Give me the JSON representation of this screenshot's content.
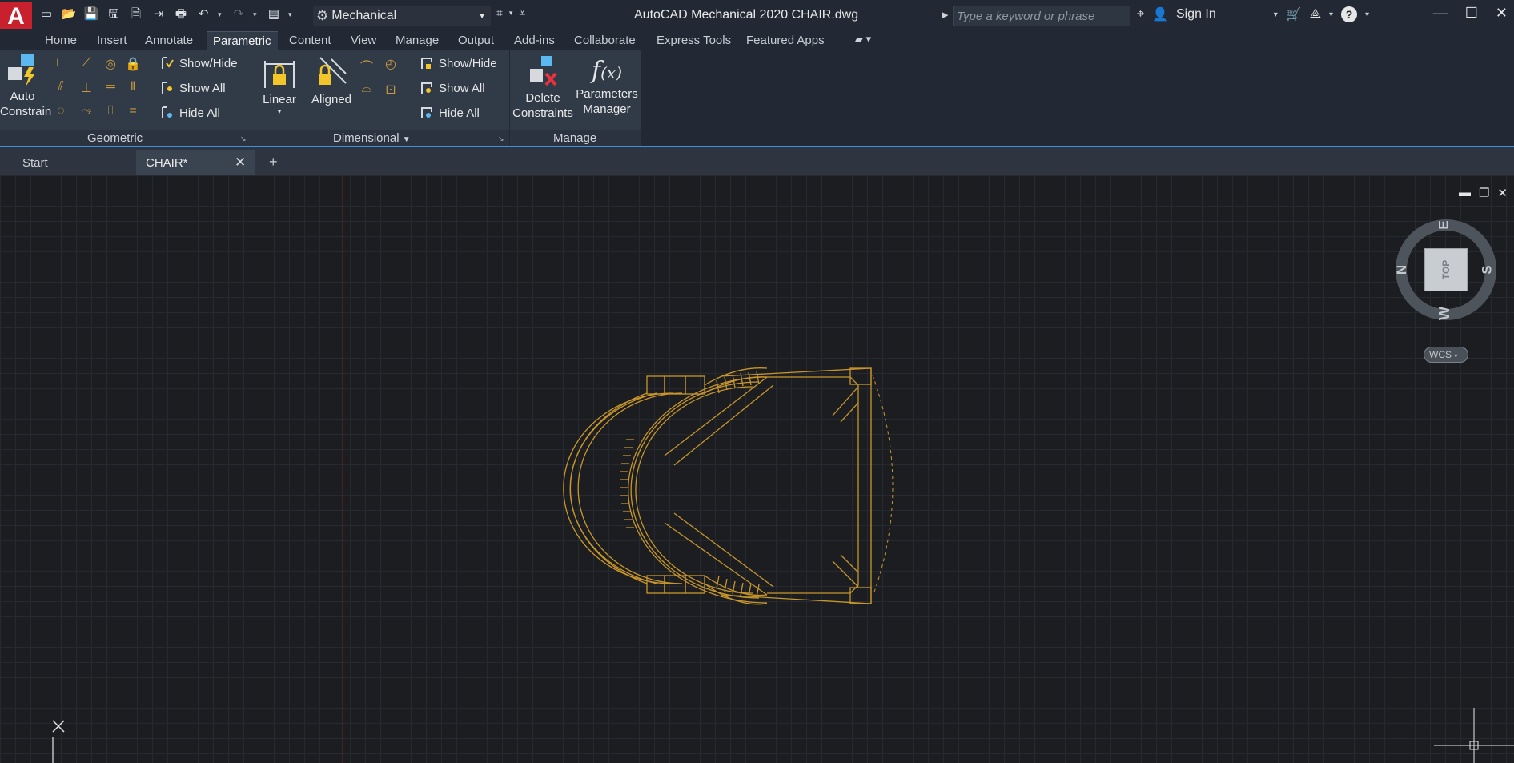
{
  "titlebar": {
    "app_logo": "A",
    "workspace": "Mechanical",
    "title": "AutoCAD Mechanical 2020    CHAIR.dwg",
    "search_placeholder": "Type a keyword or phrase",
    "sign_in": "Sign In"
  },
  "ribbon_tabs": [
    "Home",
    "Insert",
    "Annotate",
    "Parametric",
    "Content",
    "View",
    "Manage",
    "Output",
    "Add-ins",
    "Collaborate",
    "Express Tools",
    "Featured Apps"
  ],
  "active_ribbon_tab": "Parametric",
  "ribbon": {
    "geometric": {
      "auto_constrain": "Auto\nConstrain",
      "show_hide": "Show/Hide",
      "show_all": "Show All",
      "hide_all": "Hide All",
      "label": "Geometric"
    },
    "dimensional": {
      "linear": "Linear",
      "aligned": "Aligned",
      "show_hide": "Show/Hide",
      "show_all": "Show All",
      "hide_all": "Hide All",
      "label": "Dimensional"
    },
    "manage": {
      "delete_constraints": "Delete\nConstraints",
      "parameters_manager": "Parameters\nManager",
      "label": "Manage"
    }
  },
  "doc_tabs": [
    "Start",
    "CHAIR*"
  ],
  "active_doc_tab": "CHAIR*",
  "viewcube": {
    "face": "TOP",
    "north": "N",
    "south": "S",
    "east": "E",
    "west": "W",
    "wcs": "WCS"
  },
  "colors": {
    "drawing": "#c8962a",
    "accent": "#3d8fd6",
    "logo": "#c8202c"
  }
}
